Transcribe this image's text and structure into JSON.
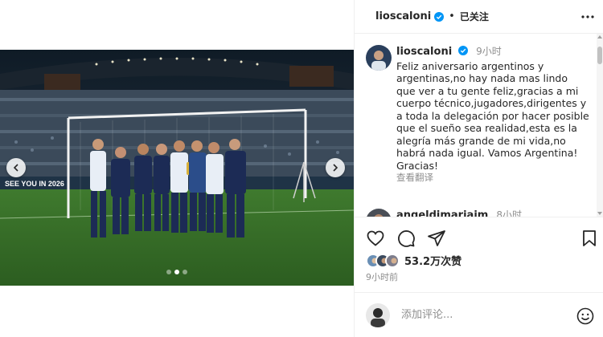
{
  "post": {
    "username": "lioscaloni",
    "follow_state": "已关注",
    "separator": "•"
  },
  "caption": {
    "username": "lioscaloni",
    "time": "9小时",
    "text": "Feliz aniversario argentinos y argentinas,no hay nada mas lindo que ver a tu gente feliz,gracias a mi cuerpo técnico,jugadores,dirigentes y a toda la delegación por hacer posible que el sueño sea realidad,esta es la alegría más grande de mi vida,no habrá nada igual. Vamos Argentina! Gracias!",
    "translate_label": "查看翻译"
  },
  "next_comment": {
    "username": "angeldimariajm",
    "time": "8小时"
  },
  "photo": {
    "banner_text": "SEE YOU IN 2026"
  },
  "carousel": {
    "slide_count": 3,
    "active_index": 1
  },
  "likes": {
    "count_label": "53.2万次赞"
  },
  "post_time": "9小时前",
  "comment_box": {
    "placeholder": "添加评论..."
  },
  "colors": {
    "verified": "#0095f6",
    "text": "#262626",
    "secondary": "#8e8e8e",
    "border": "#efefef"
  },
  "icons": [
    "chevron-left-icon",
    "chevron-right-icon",
    "verified-badge-icon",
    "more-options-icon",
    "heart-icon",
    "comment-icon",
    "share-icon",
    "bookmark-icon",
    "emoji-icon"
  ]
}
